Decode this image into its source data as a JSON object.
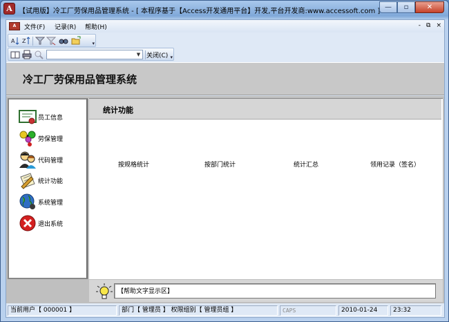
{
  "window": {
    "title": "【试用版】冷工厂劳保用品管理系统 - [ 本程序基于【Access开发通用平台】开发,平台开发商:www.accessoft.com ] - [控...",
    "minimize_label": "—",
    "restore_label": "▫",
    "close_label": "✕"
  },
  "menubar": {
    "doc_icon": "A",
    "items": [
      {
        "label": "文件(F)"
      },
      {
        "label": "记录(R)"
      },
      {
        "label": "帮助(H)"
      }
    ],
    "mdi_min": "-",
    "mdi_restore": "⧉",
    "mdi_close": "×"
  },
  "toolbar1": {
    "icons": [
      "sort-ascending-icon",
      "sort-descending-icon",
      "filter-by-selection-icon",
      "filter-by-form-icon",
      "find-icon",
      "open-folder-icon"
    ]
  },
  "toolbar2": {
    "combo_value": "",
    "close_label": "关闭(C)"
  },
  "header": {
    "app_title": "冷工厂劳保用品管理系统"
  },
  "nav": {
    "items": [
      {
        "label": "员工信息",
        "icon": "certificate-icon"
      },
      {
        "label": "劳保管理",
        "icon": "molecule-icon"
      },
      {
        "label": "代码管理",
        "icon": "users-icon"
      },
      {
        "label": "统计功能",
        "icon": "notepad-pen-icon"
      },
      {
        "label": "系统管理",
        "icon": "globe-icon"
      },
      {
        "label": "退出系统",
        "icon": "exit-icon"
      }
    ]
  },
  "main": {
    "section_title": "统计功能",
    "functions": [
      {
        "label": "按规格统计"
      },
      {
        "label": "按部门统计"
      },
      {
        "label": "统计汇总"
      },
      {
        "label": "领用记录（签名）"
      }
    ]
  },
  "help": {
    "text": "【帮助文字显示区】"
  },
  "status": {
    "user": "当前用户【  000001  】",
    "dept": "部门【  管理员  】  权限组别【  管理员组  】",
    "caps": "CAPS",
    "date": "2010-01-24",
    "time": "23:32"
  },
  "colors": {
    "accent": "#5d8fc9",
    "header_band": "#c8c8c8",
    "exit_red": "#d42020"
  }
}
